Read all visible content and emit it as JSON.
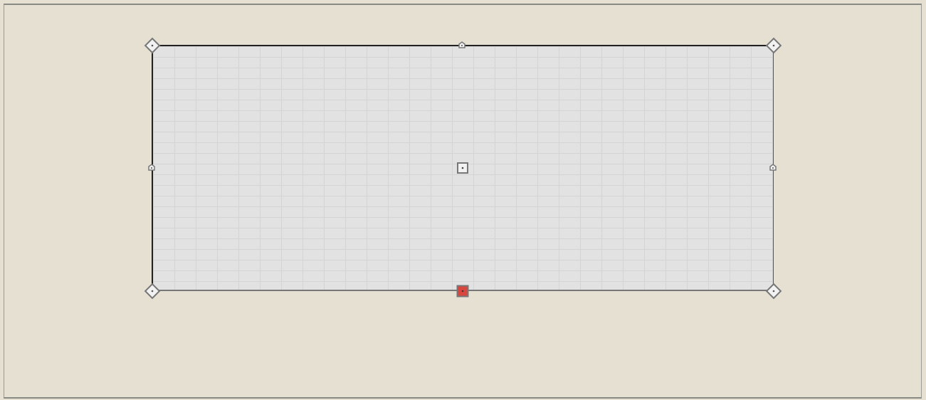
{
  "canvas": {
    "background_color": "#e6e0d3",
    "selected_object": {
      "type": "wall",
      "material_pattern": "brick",
      "fill_color": "#e2e2e2",
      "handles": {
        "corner": [
          "top-left",
          "top-right",
          "bottom-left",
          "bottom-right"
        ],
        "edge": [
          "top",
          "left",
          "right",
          "bottom"
        ],
        "center": "move",
        "active": "bottom",
        "active_color": "#d9463e"
      }
    }
  }
}
